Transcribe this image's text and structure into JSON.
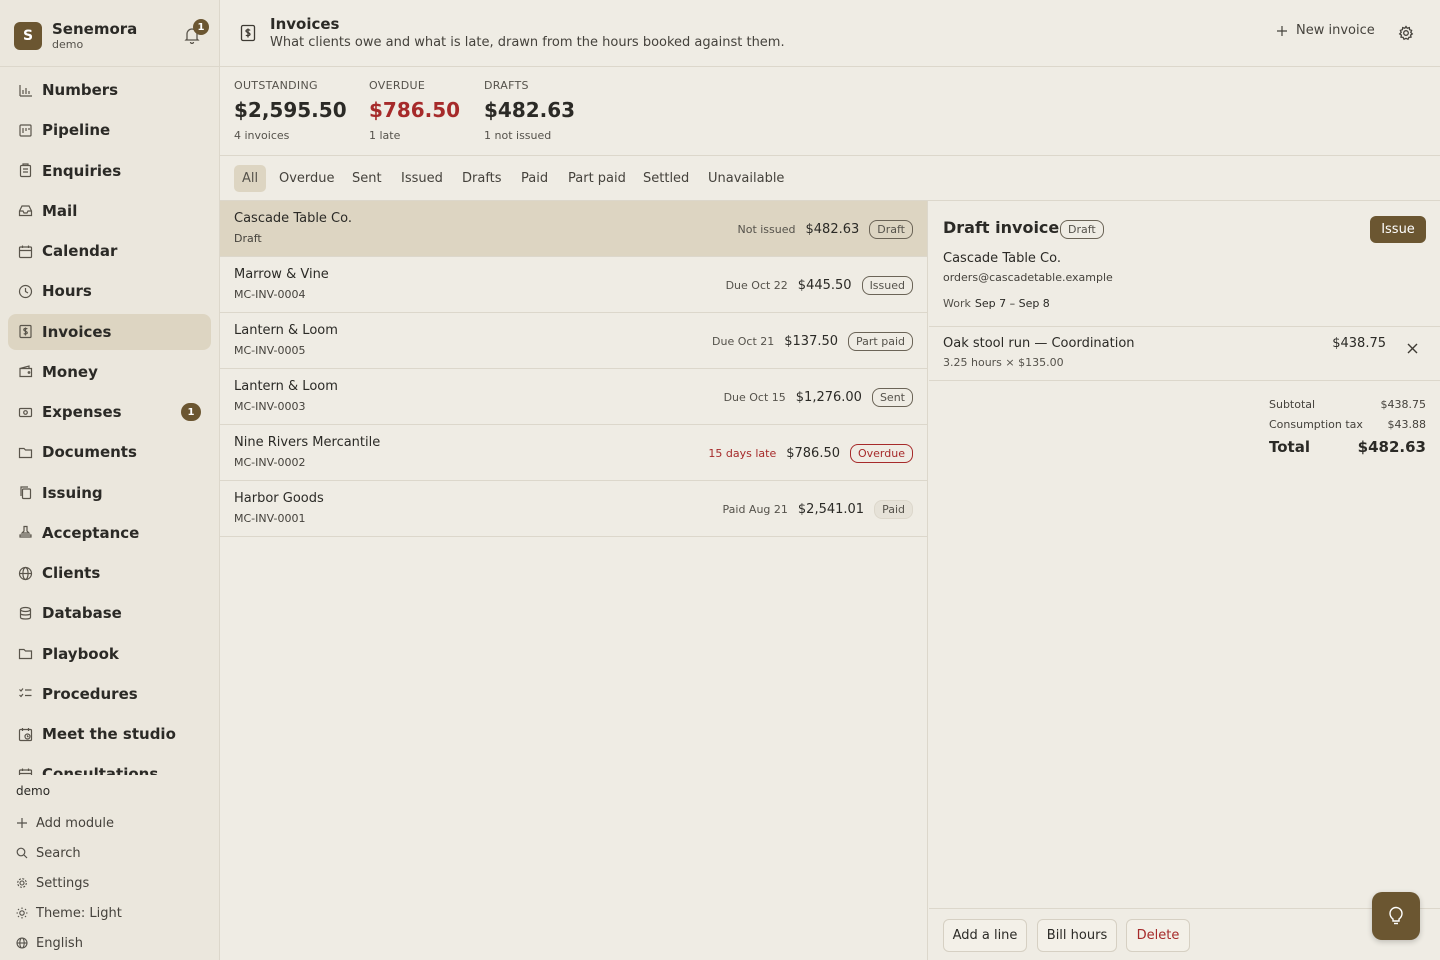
{
  "brand": {
    "initial": "S",
    "name": "Senemora",
    "workspace": "demo",
    "notifications": "1"
  },
  "nav": [
    {
      "label": "Numbers",
      "icon": "bar-chart-icon"
    },
    {
      "label": "Pipeline",
      "icon": "pipeline-icon"
    },
    {
      "label": "Enquiries",
      "icon": "clipboard-icon"
    },
    {
      "label": "Mail",
      "icon": "inbox-icon"
    },
    {
      "label": "Calendar",
      "icon": "calendar-icon"
    },
    {
      "label": "Hours",
      "icon": "clock-icon"
    },
    {
      "label": "Invoices",
      "icon": "invoice-icon",
      "active": true
    },
    {
      "label": "Money",
      "icon": "wallet-icon"
    },
    {
      "label": "Expenses",
      "icon": "receipt-icon",
      "badge": "1"
    },
    {
      "label": "Documents",
      "icon": "folder-icon"
    },
    {
      "label": "Issuing",
      "icon": "copy-icon"
    },
    {
      "label": "Acceptance",
      "icon": "stamp-icon"
    },
    {
      "label": "Clients",
      "icon": "globe-icon"
    },
    {
      "label": "Database",
      "icon": "database-icon"
    },
    {
      "label": "Playbook",
      "icon": "folder-icon"
    },
    {
      "label": "Procedures",
      "icon": "checklist-icon"
    },
    {
      "label": "Meet the studio",
      "icon": "calendar-clock-icon"
    },
    {
      "label": "Consultations",
      "icon": "calendar-icon"
    }
  ],
  "sidebar_bottom": {
    "user": "demo",
    "add_module": "Add module",
    "search": "Search",
    "settings": "Settings",
    "theme": "Theme: Light",
    "language": "English"
  },
  "header": {
    "title": "Invoices",
    "subtitle": "What clients owe and what is late, drawn from the hours booked against them.",
    "new_invoice": "New invoice"
  },
  "stats": {
    "outstanding": {
      "label": "OUTSTANDING",
      "value": "$2,595.50",
      "sub": "4 invoices"
    },
    "overdue": {
      "label": "OVERDUE",
      "value": "$786.50",
      "sub": "1 late"
    },
    "drafts": {
      "label": "DRAFTS",
      "value": "$482.63",
      "sub": "1 not issued"
    }
  },
  "filters": [
    "All",
    "Overdue",
    "Sent",
    "Issued",
    "Drafts",
    "Paid",
    "Part paid",
    "Settled",
    "Unavailable"
  ],
  "invoices": [
    {
      "client": "Cascade Table Co.",
      "ref": "Draft",
      "meta": "Not issued",
      "amount": "$482.63",
      "status": "Draft"
    },
    {
      "client": "Marrow & Vine",
      "ref": "MC-INV-0004",
      "meta": "Due Oct 22",
      "amount": "$445.50",
      "status": "Issued"
    },
    {
      "client": "Lantern & Loom",
      "ref": "MC-INV-0005",
      "meta": "Due Oct 21",
      "amount": "$137.50",
      "status": "Part paid"
    },
    {
      "client": "Lantern & Loom",
      "ref": "MC-INV-0003",
      "meta": "Due Oct 15",
      "amount": "$1,276.00",
      "status": "Sent"
    },
    {
      "client": "Nine Rivers Mercantile",
      "ref": "MC-INV-0002",
      "meta": "15 days late",
      "amount": "$786.50",
      "status": "Overdue"
    },
    {
      "client": "Harbor Goods",
      "ref": "MC-INV-0001",
      "meta": "Paid Aug 21",
      "amount": "$2,541.01",
      "status": "Paid"
    }
  ],
  "detail": {
    "title": "Draft invoice",
    "status": "Draft",
    "issue_label": "Issue",
    "client": "Cascade Table Co.",
    "email": "orders@cascadetable.example",
    "work_label": "Work",
    "work_range": "Sep 7 – Sep 8",
    "line": {
      "title": "Oak stool run — Coordination",
      "sub": "3.25 hours × $135.00",
      "amount": "$438.75"
    },
    "subtotal_label": "Subtotal",
    "subtotal": "$438.75",
    "tax_label": "Consumption tax",
    "tax": "$43.88",
    "total_label": "Total",
    "total": "$482.63",
    "add_line": "Add a line",
    "bill_hours": "Bill hours",
    "delete": "Delete"
  },
  "colors": {
    "accent": "#6b5631",
    "danger": "#a62a2a",
    "background": "#efece4",
    "sidebar": "#ebe7dd",
    "selected": "#ddd5c2"
  }
}
